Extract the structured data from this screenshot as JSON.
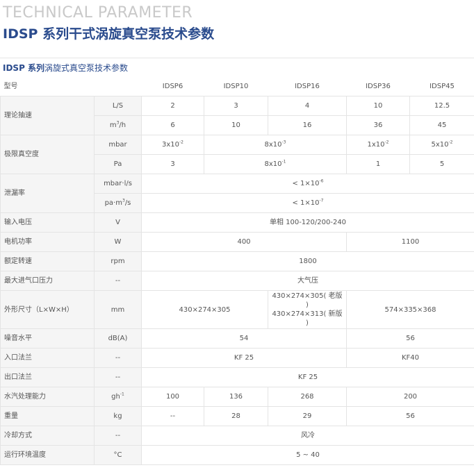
{
  "header": {
    "title_en": "TECHNICAL PARAMETER",
    "title_cn": "IDSP 系列干式涡旋真空泵技术参数"
  },
  "table_title": {
    "bold": "IDSP 系列",
    "rest": "涡旋式真空泵技术参数"
  },
  "columns": {
    "label": "型号",
    "models": [
      "IDSP6",
      "IDSP10",
      "IDSP16",
      "IDSP36",
      "IDSP45"
    ]
  },
  "rows": {
    "speed": {
      "label": "理论抽速",
      "unit1": "L/S",
      "v1": [
        "2",
        "3",
        "4",
        "10",
        "12.5"
      ],
      "unit2_base": "m",
      "unit2_sup": "3",
      "unit2_tail": "/h",
      "v2": [
        "6",
        "10",
        "16",
        "36",
        "45"
      ]
    },
    "vacuum": {
      "label": "极限真空度",
      "unit1": "mbar",
      "mbar": [
        {
          "b": "3x10",
          "e": "-2"
        },
        {
          "b": "8x10",
          "e": "-3"
        },
        {
          "b": "1x10",
          "e": "-2"
        },
        {
          "b": "5x10",
          "e": "-2"
        }
      ],
      "unit2": "Pa",
      "pa": [
        {
          "b": "3",
          "e": ""
        },
        {
          "b": "8x10",
          "e": "-1"
        },
        {
          "b": "1",
          "e": ""
        },
        {
          "b": "5",
          "e": ""
        }
      ]
    },
    "leak": {
      "label": "泄漏率",
      "unit1": "mbar·l/s",
      "v1_base": "< 1×10",
      "v1_exp": "-6",
      "unit2_base": "pa·m",
      "unit2_sup": "3",
      "unit2_tail": "/s",
      "v2_base": "< 1×10",
      "v2_exp": "-7"
    },
    "voltage": {
      "label": "输入电压",
      "unit": "V",
      "value": "单相 100-120/200-240"
    },
    "power": {
      "label": "电机功率",
      "unit": "W",
      "v1": "400",
      "v2": "1100"
    },
    "rpm": {
      "label": "额定转速",
      "unit": "rpm",
      "value": "1800"
    },
    "inlet_pressure": {
      "label": "最大进气口压力",
      "unit": "--",
      "value": "大气压"
    },
    "dims": {
      "label": "外形尺寸（L×W×H）",
      "unit": "mm",
      "v1": "430×274×305",
      "v2a": "430×274×305( 老版 )",
      "v2b": "430×274×313( 新版 )",
      "v3": "574×335×368"
    },
    "noise": {
      "label": "噪音水平",
      "unit": "dB(A)",
      "v1": "54",
      "v2": "56"
    },
    "inlet": {
      "label": "入口法兰",
      "unit": "--",
      "v1": "KF 25",
      "v2": "KF40"
    },
    "outlet": {
      "label": "出口法兰",
      "unit": "--",
      "value": "KF 25"
    },
    "water": {
      "label": "水汽处理能力",
      "unit_base": "gh",
      "unit_sup": "-1",
      "v": [
        "100",
        "136",
        "268",
        "200"
      ]
    },
    "weight": {
      "label": "重量",
      "unit": "kg",
      "v": [
        "--",
        "28",
        "29",
        "56"
      ]
    },
    "cooling": {
      "label": "冷却方式",
      "unit": "--",
      "value": "风冷"
    },
    "temp": {
      "label": "运行环境温度",
      "unit": "°C",
      "value": "5 ~ 40"
    }
  }
}
